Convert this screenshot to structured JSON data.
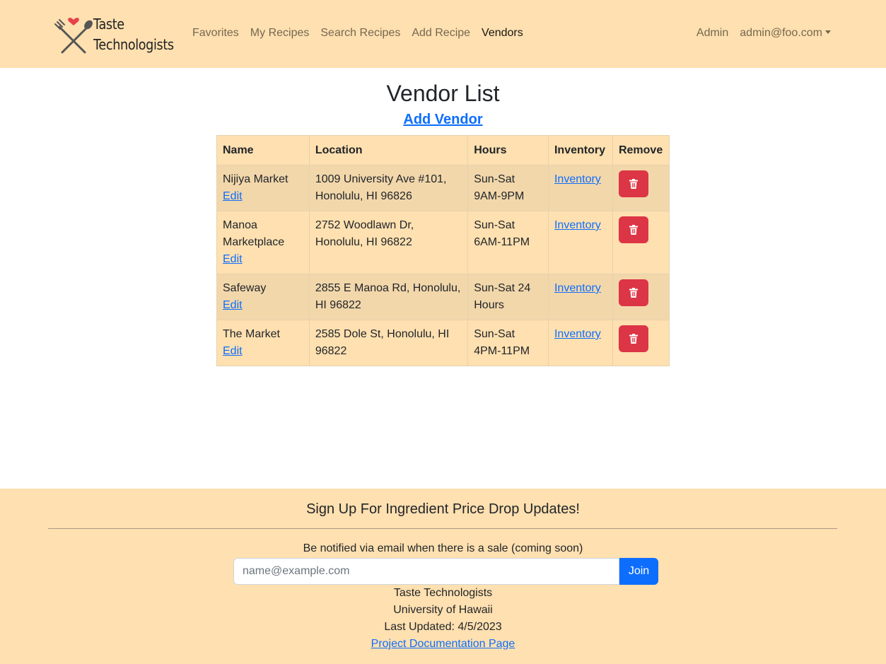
{
  "brand": {
    "line1": "Taste",
    "line2": "Technologists",
    "logo_icon": "fork-spoon-heart-icon"
  },
  "nav": {
    "links": [
      {
        "label": "Favorites",
        "active": false
      },
      {
        "label": "My Recipes",
        "active": false
      },
      {
        "label": "Search Recipes",
        "active": false
      },
      {
        "label": "Add Recipe",
        "active": false
      },
      {
        "label": "Vendors",
        "active": true
      }
    ],
    "admin_label": "Admin",
    "user_label": "admin@foo.com"
  },
  "main": {
    "title": "Vendor List",
    "add_vendor_label": "Add Vendor"
  },
  "table": {
    "headers": [
      "Name",
      "Location",
      "Hours",
      "Inventory",
      "Remove"
    ],
    "edit_label": "Edit",
    "inventory_label": "Inventory",
    "rows": [
      {
        "name": "Nijiya Market",
        "location": "1009 University Ave #101, Honolulu, HI 96826",
        "hours": "Sun-Sat 9AM-9PM"
      },
      {
        "name": "Manoa Marketplace",
        "location": "2752 Woodlawn Dr, Honolulu, HI 96822",
        "hours": "Sun-Sat 6AM-11PM"
      },
      {
        "name": "Safeway",
        "location": "2855 E Manoa Rd, Honolulu, HI 96822",
        "hours": "Sun-Sat 24 Hours"
      },
      {
        "name": "The Market",
        "location": "2585 Dole St, Honolulu, HI 96822",
        "hours": "Sun-Sat 4PM-11PM"
      }
    ]
  },
  "footer": {
    "heading": "Sign Up For Ingredient Price Drop Updates!",
    "note": "Be notified via email when there is a sale (coming soon)",
    "email_placeholder": "name@example.com",
    "join_label": "Join",
    "org": "Taste Technologists",
    "university": "University of Hawaii",
    "last_updated": "Last Updated: 4/5/2023",
    "docs_link": "Project Documentation Page"
  },
  "colors": {
    "navbar_bg": "#ffe0b0",
    "row_odd": "#f2d7ab",
    "link": "#0d6efd",
    "danger": "#dc3545"
  }
}
